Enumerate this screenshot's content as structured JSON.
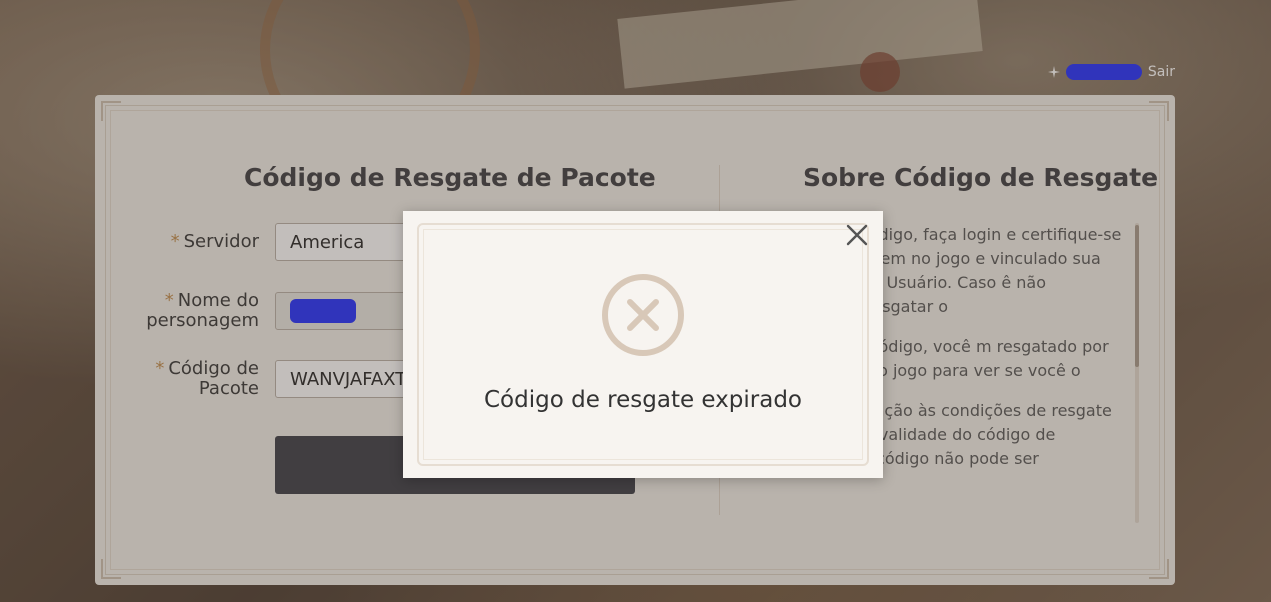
{
  "header": {
    "logout_label": "Sair"
  },
  "redeem": {
    "title": "Código de Resgate de Pacote",
    "server_label": "Servidor",
    "server_value": "America",
    "character_label_line1": "Nome do",
    "character_label_line2": "personagem",
    "code_label_line1": "Código de",
    "code_label_line2": "Pacote",
    "code_value": "WANVJAFAXT"
  },
  "about": {
    "title": "Sobre Código de Resgate",
    "paragraphs": [
      "sgatar um código, faça login e certifique-se de ter criado em no jogo e vinculado sua no Central de Usuário. Caso ê não conseguirá resgatar o",
      "esgatar um código, você m resgatado por e-mail no e no jogo para ver se você o",
      "3. Preste atenção às condições de resgate e período de validade do código de resgate. Um código não pode ser"
    ]
  },
  "modal": {
    "message": "Código de resgate expirado"
  },
  "colors": {
    "panel_bg": "#f2efe9",
    "button_dark": "#393b44",
    "required_star": "#c08a4a",
    "error_icon": "#d8c8b8"
  },
  "icons": {
    "close": "close-icon",
    "error": "error-circle-x-icon",
    "sparkle": "sparkle-icon"
  }
}
